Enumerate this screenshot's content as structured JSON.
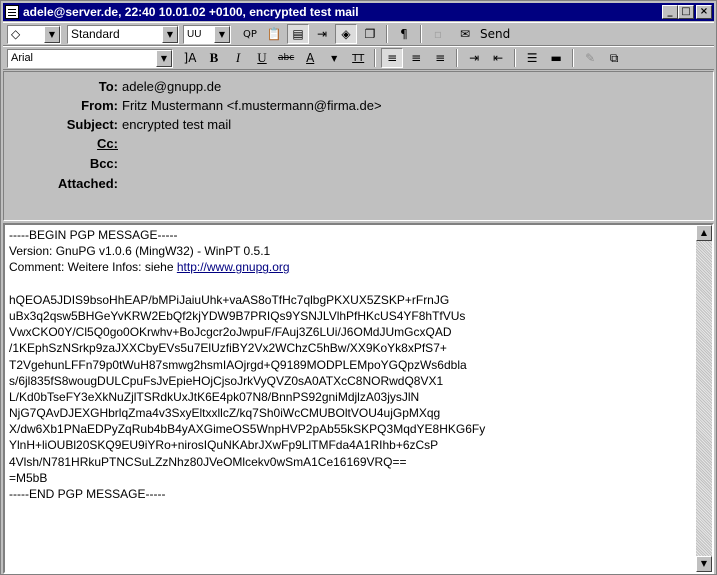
{
  "window": {
    "title": "adele@server.de, 22:40 10.01.02 +0100, encrypted test mail",
    "minimize_glyph": "_",
    "maximize_glyph": "□",
    "close_glyph": "×"
  },
  "toolbar1": {
    "priority_glyph": "◇",
    "stationery_value": "Standard",
    "encoding_value": "UU",
    "qp_label": "QP",
    "send_label": "Send"
  },
  "toolbar2": {
    "font_value": "Arial",
    "bold_label": "B",
    "italic_label": "I",
    "underline_label": "U",
    "strike_label": "abc",
    "tt_label": "TT"
  },
  "headers": [
    {
      "label": "To:",
      "value": "adele@gnupp.de"
    },
    {
      "label": "From:",
      "value": "Fritz Mustermann <f.mustermann@firma.de>"
    },
    {
      "label": "Subject:",
      "value": "encrypted test mail"
    },
    {
      "label": "Cc:",
      "value": ""
    },
    {
      "label": "Bcc:",
      "value": ""
    },
    {
      "label": "Attached:",
      "value": ""
    }
  ],
  "message": {
    "lines": [
      "-----BEGIN PGP MESSAGE-----",
      "Version: GnuPG v1.0.6 (MingW32) - WinPT 0.5.1",
      "Comment: Weitere Infos: siehe ",
      "",
      "hQEOA5JDIS9bsoHhEAP/bMPiJaiuUhk+vaAS8oTfHc7qlbgPKXUX5ZSKP+rFrnJG",
      "uBx3q2qsw5BHGeYvKRW2EbQf2kjYDW9B7PRIQs9YSNJLVlhPfHKcUS4YF8hTfVUs",
      "VwxCKO0Y/Cl5Q0go0OKrwhv+BoJcgcr2oJwpuF/FAuj3Z6LUi/J6OMdJUmGcxQAD",
      "/1KEphSzNSrkp9zaJXXCbyEVs5u7ElUzfiBY2Vx2WChzC5hBw/XX9KoYk8xPfS7+",
      "T2VgehunLFFn79p0tWuH87smwg2hsmIAOjrgd+Q9189MODPLEMpoYGQpzWs6dbla",
      "s/6jl835fS8wougDULCpuFsJvEpieHOjCjsoJrkVyQVZ0sA0ATXcC8NORwdQ8VX1",
      "L/Kd0bTseFY3eXkNuZjlTSRdkUxJtK6E4pk07N8/BnnPS92gniMdjlzA03jysJlN",
      "NjG7QAvDJEXGHbrlqZma4v3SxyEltxxllcZ/kq7Sh0iWcCMUBOltVOU4ujGpMXqg",
      "X/dw6Xb1PNaEDPyZqRub4bB4yAXGimeOS5WnpHVP2pAb55kSKPQ3MqdYE8HKG6Fy",
      "YlnH+liOUBl20SKQ9EU9iYRo+nirosIQuNKAbrJXwFp9LlTMFda4A1RIhb+6zCsP",
      "4Vlsh/N781HRkuPTNCSuLZzNhz80JVeOMlcekv0wSmA1Ce16169VRQ==",
      "=M5bB",
      "-----END PGP MESSAGE-----"
    ],
    "comment_link": "http://www.gnupg.org"
  }
}
